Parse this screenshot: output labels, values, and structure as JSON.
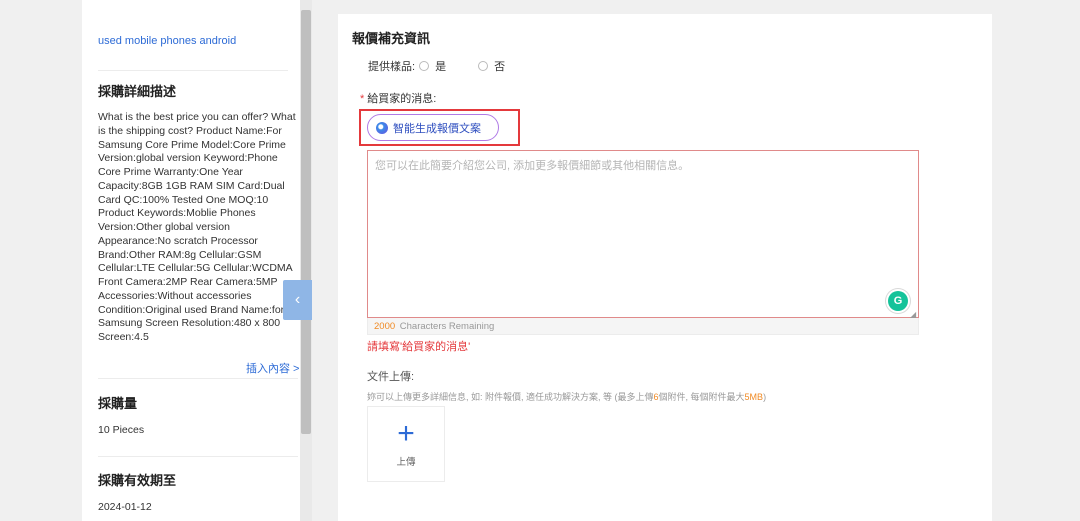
{
  "left": {
    "product_link": "used mobile phones android",
    "description_title": "採購詳細描述",
    "description": "What is the best price you can offer? What is the shipping cost? Product Name:For Samsung Core Prime Model:Core Prime Version:global version Keyword:Phone Core Prime Warranty:One Year Capacity:8GB 1GB RAM SIM Card:Dual Card QC:100% Tested One MOQ:10 Product Keywords:Moblie Phones Version:Other global version Appearance:No scratch Processor Brand:Other RAM:8g Cellular:GSM Cellular:LTE Cellular:5G Cellular:WCDMA Front Camera:2MP Rear Camera:5MP Accessories:Without accessories Condition:Original used Brand Name:for Samsung Screen Resolution:480 x 800 Screen:4.5",
    "insert_link": "插入內容 >",
    "quantity_title": "採購量",
    "quantity_value": "10 Pieces",
    "expiry_title": "採購有效期至",
    "expiry_value": "2024-01-12"
  },
  "sidebar_toggle": {
    "icon": "chevron-left-icon",
    "glyph": "‹"
  },
  "main": {
    "title": "報價補充資訊",
    "sample": {
      "label": "提供樣品:",
      "options": [
        "是",
        "否"
      ]
    },
    "message": {
      "required_mark": "*",
      "label": "給買家的消息:",
      "ai_button": "智能生成報價文案",
      "placeholder": "您可以在此簡要介紹您公司, 添加更多報價細節或其他相關信息。",
      "counter_number": "2000",
      "counter_text": "Characters Remaining",
      "error": "請填寫'給買家的消息'",
      "grammarly_glyph": "G"
    },
    "upload": {
      "label": "文件上傳:",
      "hint_pre": "妳可以上傳更多詳細信息, 如: 附件報價, 適任成功解決方案, 等 (最多上傳",
      "hint_count": "6",
      "hint_mid": "個附件, 每個附件最大",
      "hint_size": "5MB",
      "hint_post": ")",
      "plus_glyph": "+",
      "button_text": "上傳"
    }
  },
  "colors": {
    "accent": "#2d6bd6",
    "error": "#e4393c",
    "highlight": "#f08a24"
  }
}
